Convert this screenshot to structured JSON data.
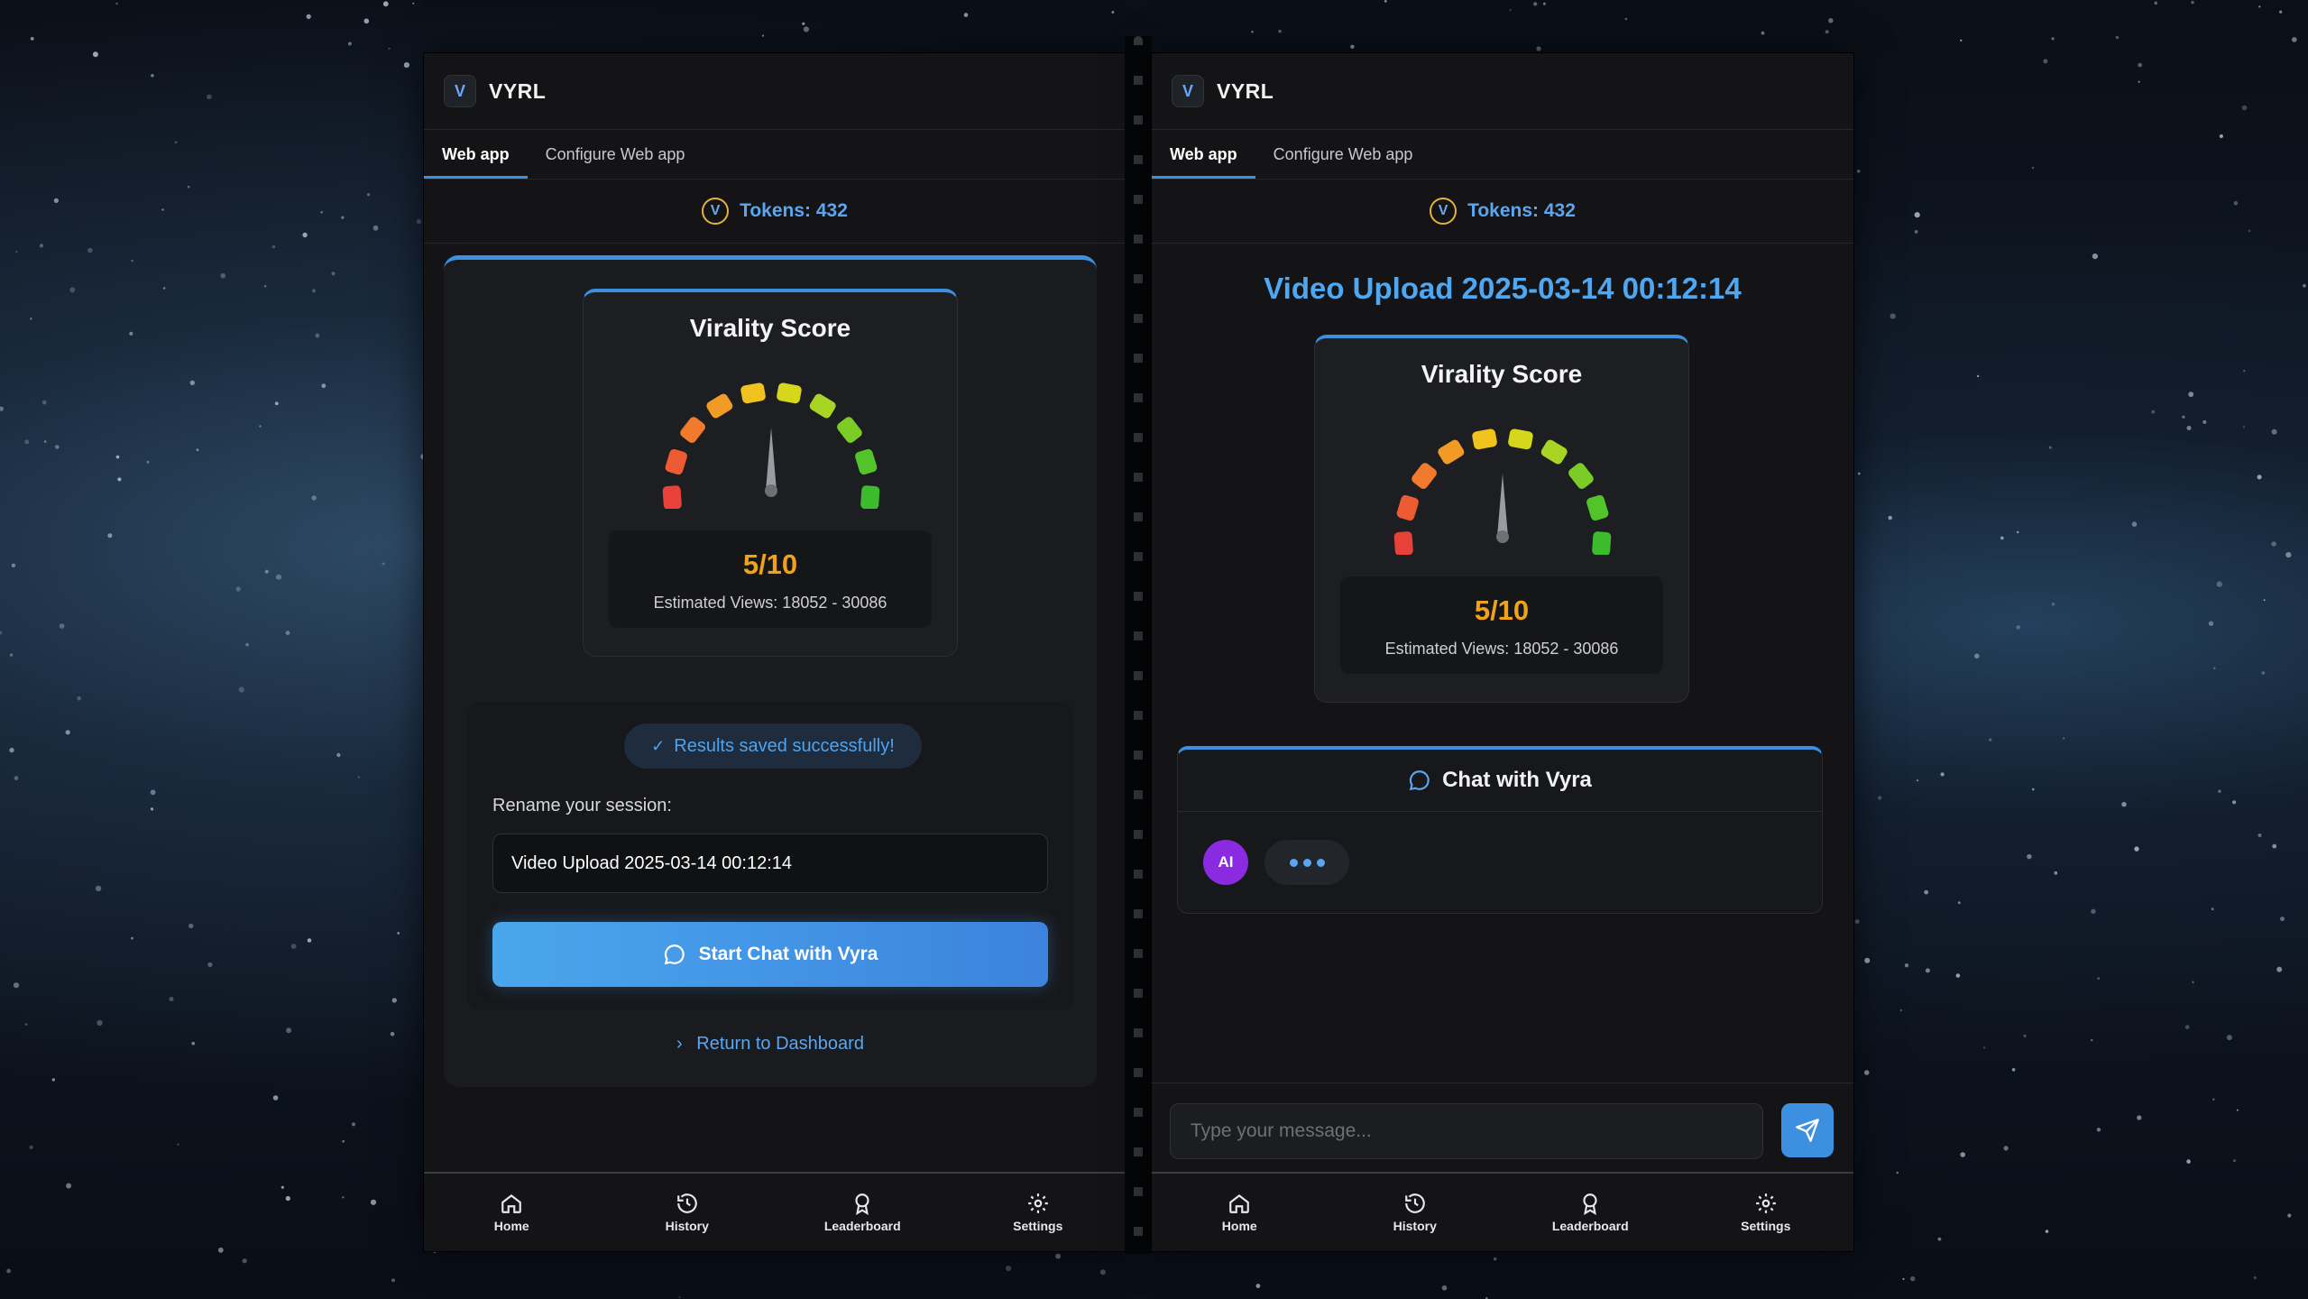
{
  "app": {
    "logo_letter": "V",
    "name": "VYRL"
  },
  "tabs": {
    "web_app": "Web app",
    "configure": "Configure Web app"
  },
  "tokens": {
    "coin_letter": "V",
    "label": "Tokens: 432"
  },
  "score": {
    "title": "Virality Score",
    "value_text": "5/10",
    "value": 5,
    "max": 10,
    "views": "Estimated Views: 18052 - 30086",
    "value_color": "#f0a21a"
  },
  "save": {
    "badge": "Results saved successfully!",
    "rename_label": "Rename your session:",
    "session_name": "Video Upload 2025-03-14 00:12:14",
    "chat_button": "Start Chat with Vyra",
    "return_link": "Return to Dashboard"
  },
  "chat": {
    "session_title": "Video Upload 2025-03-14 00:12:14",
    "header": "Chat with Vyra",
    "avatar": "AI",
    "input_placeholder": "Type your message..."
  },
  "nav": {
    "home": "Home",
    "history": "History",
    "leaderboard": "Leaderboard",
    "settings": "Settings"
  },
  "icons": [
    "v-logo-icon",
    "token-coin-icon",
    "check-icon",
    "chat-bubble-icon",
    "chevron-right-icon",
    "send-icon",
    "home-icon",
    "history-icon",
    "leaderboard-icon",
    "gear-icon"
  ],
  "colors": {
    "accent": "#3d8fe0",
    "link": "#5aa6f0",
    "background": "#141416",
    "ai_avatar": "#8a2be2"
  }
}
